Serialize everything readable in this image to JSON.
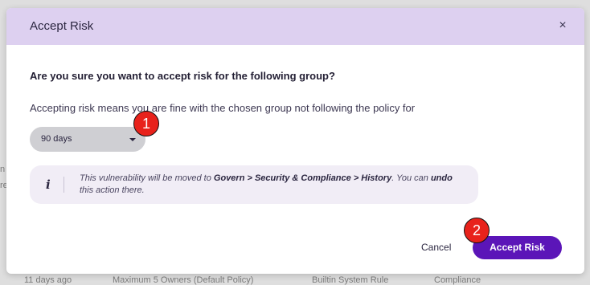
{
  "background": {
    "left_fragments": [
      "n",
      "re"
    ],
    "bottom_row": [
      "11 days ago",
      "Maximum 5 Owners (Default Policy)",
      "Builtin System Rule",
      "Compliance"
    ]
  },
  "modal": {
    "title": "Accept Risk",
    "close_icon": "×",
    "question": "Are you sure you want to accept risk for the following group?",
    "description": "Accepting risk means you are fine with the chosen group not following the policy for",
    "duration_select": {
      "selected": "90 days"
    },
    "info": {
      "icon": "i",
      "text_1": "This vulnerability will be moved to ",
      "path": "Govern > Security & Compliance > History",
      "text_2": ". You can ",
      "undo": "undo",
      "text_3": " this action there."
    },
    "cancel_label": "Cancel",
    "accept_label": "Accept Risk"
  },
  "annotations": {
    "badge_1": "1",
    "badge_2": "2"
  },
  "colors": {
    "header_bg": "#ddd0f0",
    "accent": "#5b15b8",
    "select_bg": "#cfcfd3",
    "info_bg": "#f1edf6",
    "badge": "#e8221b"
  }
}
